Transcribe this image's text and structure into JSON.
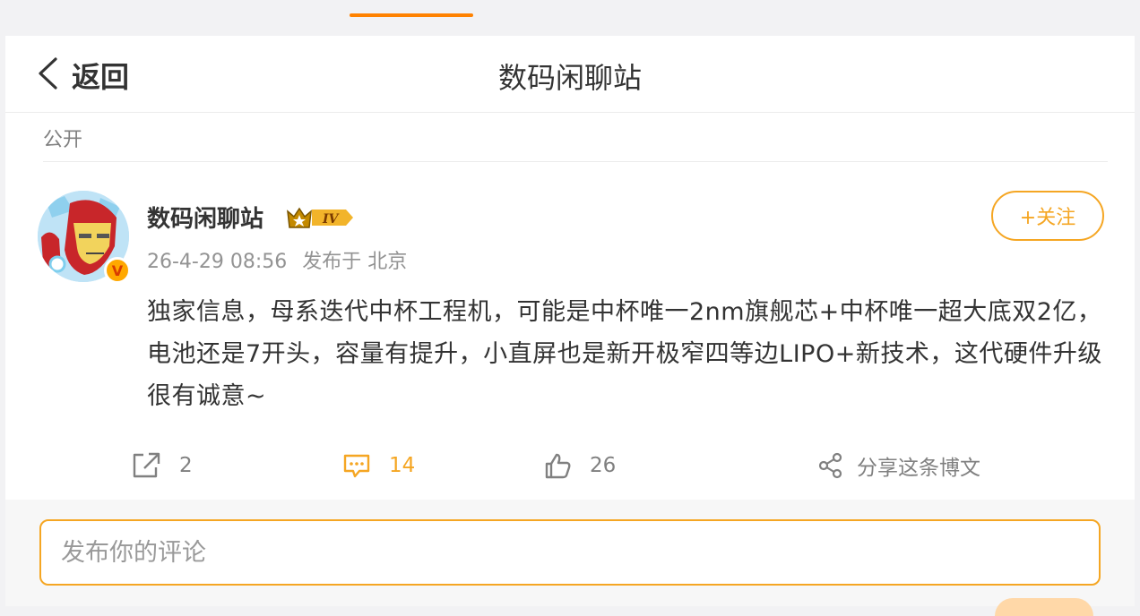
{
  "header": {
    "back_label": "返回",
    "title": "数码闲聊站"
  },
  "post": {
    "visibility": "公开",
    "author": {
      "name": "数码闲聊站",
      "level_badge": "IV",
      "verified_mark": "V"
    },
    "timestamp": "26-4-29 08:56",
    "location": "发布于 北京",
    "follow_label": "+关注",
    "content": "独家信息，母系迭代中杯工程机，可能是中杯唯一2nm旗舰芯+中杯唯一超大底双2亿，电池还是7开头，容量有提升，小直屏也是新开极窄四等边LIPO+新技术，这代硬件升级很有诚意~",
    "actions": {
      "repost_count": "2",
      "comment_count": "14",
      "like_count": "26",
      "share_label": "分享这条博文"
    }
  },
  "comment_box": {
    "placeholder": "发布你的评论"
  },
  "colors": {
    "accent": "#ff8200",
    "follow": "#f5a623",
    "text": "#333333",
    "muted": "#939393"
  }
}
